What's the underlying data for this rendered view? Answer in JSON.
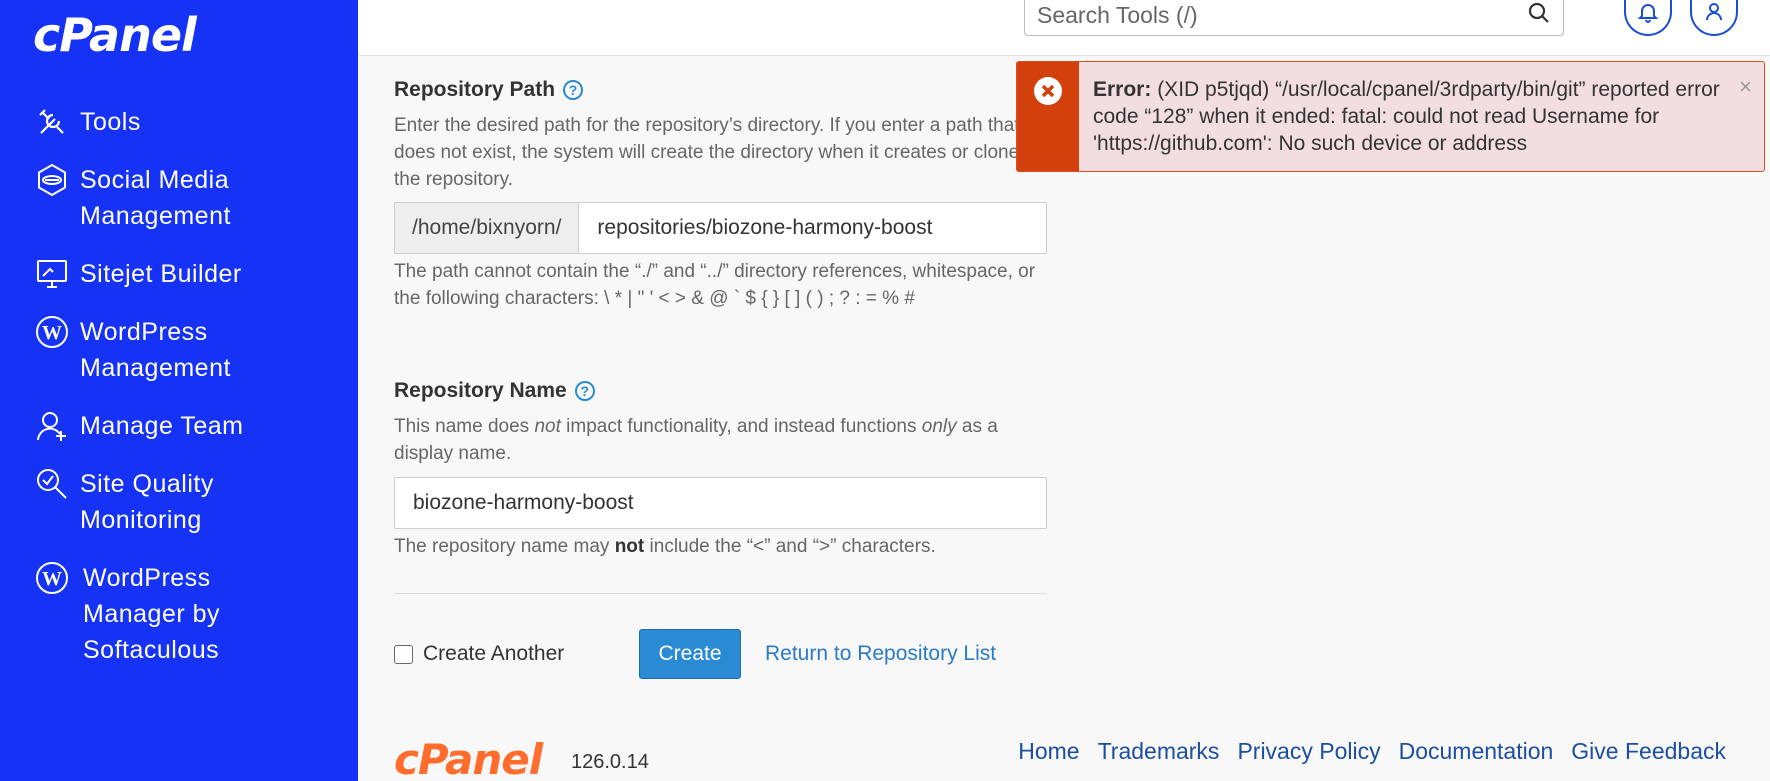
{
  "sidebar": {
    "logo": "cPanel",
    "items": [
      {
        "label": "Tools",
        "icon": "tools-icon"
      },
      {
        "label": "Social Media\nManagement",
        "icon": "social-media-icon"
      },
      {
        "label": "Sitejet Builder",
        "icon": "sitejet-icon"
      },
      {
        "label": "WordPress\nManagement",
        "icon": "wordpress-icon"
      },
      {
        "label": "Manage Team",
        "icon": "manage-team-icon"
      },
      {
        "label": "Site Quality\nMonitoring",
        "icon": "site-quality-icon"
      },
      {
        "label": "WordPress\nManager by\nSoftaculous",
        "icon": "wordpress-icon"
      }
    ]
  },
  "topbar": {
    "search_placeholder": "Search Tools (/)"
  },
  "repo_path": {
    "title": "Repository Path",
    "desc": "Enter the desired path for the repository’s directory. If you enter a path that does not exist, the system will create the directory when it creates or clones the repository.",
    "prefix": "/home/bixnyorn/",
    "value": "repositories/biozone-harmony-boost",
    "hint": "The path cannot contain the “./” and “../” directory references, whitespace, or the following characters: \\ * | \" ' < > & @ ` $ { } [ ] ( ) ; ? : = % #"
  },
  "repo_name": {
    "title": "Repository Name",
    "desc_before": "This name does ",
    "desc_em1": "not",
    "desc_mid": " impact functionality, and instead functions ",
    "desc_em2": "only",
    "desc_after": " as a display name.",
    "value": "biozone-harmony-boost",
    "hint_before": "The repository name may ",
    "hint_bold": "not",
    "hint_after": " include the “<” and “>” characters."
  },
  "actions": {
    "create_another": "Create Another",
    "create": "Create",
    "return_link": "Return to Repository List"
  },
  "alert": {
    "label": "Error:",
    "message": " (XID p5tjqd) “/usr/local/cpanel/3rdparty/bin/git” reported error code “128” when it ended: fatal: could not read Username for 'https://github.com': No such device or address",
    "close": "×"
  },
  "footer": {
    "logo": "cPanel",
    "version": "126.0.14",
    "links": [
      "Home",
      "Trademarks",
      "Privacy Policy",
      "Documentation",
      "Give Feedback"
    ]
  },
  "colors": {
    "sidebar_bg": "#1532f5",
    "accent": "#2a8ad4",
    "error": "#d2410c",
    "brand_orange": "#ff6c2c"
  }
}
